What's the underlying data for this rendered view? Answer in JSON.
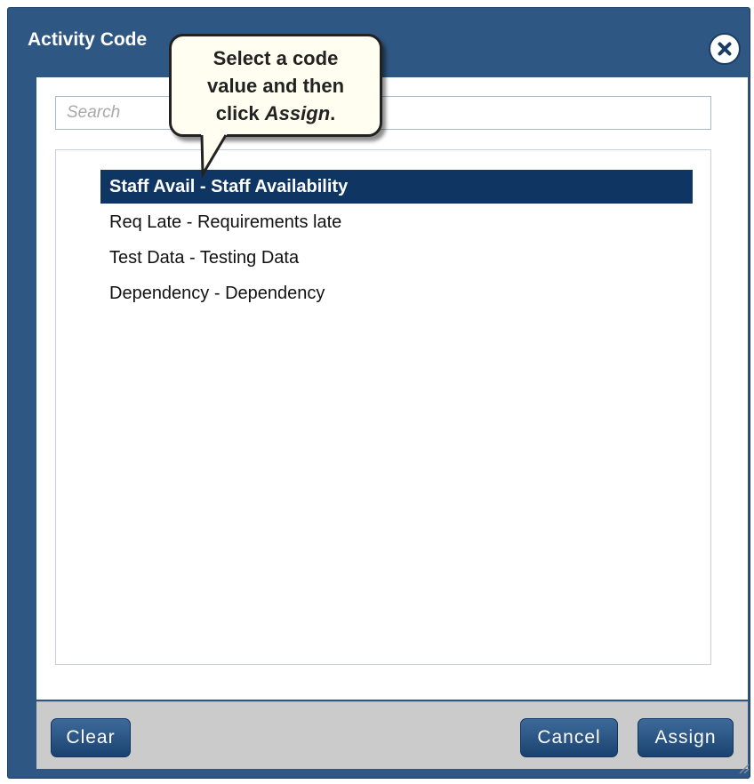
{
  "dialog": {
    "title": "Activity Code",
    "close_icon": "close-circle-icon"
  },
  "search": {
    "placeholder": "Search",
    "value": ""
  },
  "list": {
    "items": [
      {
        "label": "Staff Avail - Staff Availability",
        "selected": true
      },
      {
        "label": "Req Late - Requirements late",
        "selected": false
      },
      {
        "label": "Test Data - Testing Data",
        "selected": false
      },
      {
        "label": "Dependency - Dependency",
        "selected": false
      }
    ]
  },
  "footer": {
    "clear_label": "Clear",
    "cancel_label": "Cancel",
    "assign_label": "Assign"
  },
  "tooltip": {
    "line1": "Select a code",
    "line2": "value and then",
    "line3_prefix": "click ",
    "line3_emphasis": "Assign",
    "line3_suffix": "."
  },
  "colors": {
    "dialog_frame": "#2f5783",
    "selected_row": "#0f3563",
    "button": "#1f4b78",
    "footer": "#cbcbcb",
    "tooltip_bg": "#fffef0"
  }
}
